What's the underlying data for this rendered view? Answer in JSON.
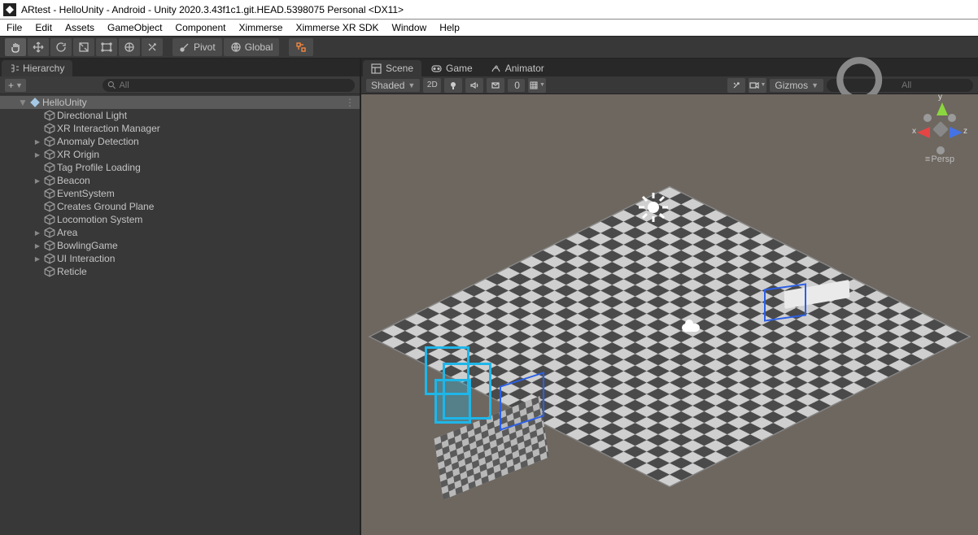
{
  "window": {
    "title": "ARtest - HelloUnity - Android - Unity 2020.3.43f1c1.git.HEAD.5398075 Personal <DX11>"
  },
  "menubar": {
    "items": [
      "File",
      "Edit",
      "Assets",
      "GameObject",
      "Component",
      "Ximmerse",
      "Ximmerse XR SDK",
      "Window",
      "Help"
    ]
  },
  "toolbar": {
    "pivot_label": "Pivot",
    "global_label": "Global"
  },
  "hierarchy": {
    "tab_label": "Hierarchy",
    "add_label": "+",
    "search_placeholder": "All",
    "scene_name": "HelloUnity",
    "items": [
      {
        "name": "Directional Light",
        "indent": 2,
        "expandable": false
      },
      {
        "name": "XR Interaction Manager",
        "indent": 2,
        "expandable": false
      },
      {
        "name": "Anomaly Detection",
        "indent": 2,
        "expandable": true
      },
      {
        "name": "XR Origin",
        "indent": 2,
        "expandable": true
      },
      {
        "name": "Tag Profile Loading",
        "indent": 2,
        "expandable": false
      },
      {
        "name": "Beacon",
        "indent": 2,
        "expandable": true
      },
      {
        "name": "EventSystem",
        "indent": 2,
        "expandable": false
      },
      {
        "name": "Creates Ground Plane",
        "indent": 2,
        "expandable": false
      },
      {
        "name": "Locomotion System",
        "indent": 2,
        "expandable": false
      },
      {
        "name": "Area",
        "indent": 2,
        "expandable": true
      },
      {
        "name": "BowlingGame",
        "indent": 2,
        "expandable": true
      },
      {
        "name": "UI Interaction",
        "indent": 2,
        "expandable": true
      },
      {
        "name": "Reticle",
        "indent": 2,
        "expandable": false
      }
    ]
  },
  "scene_panel": {
    "tabs": [
      {
        "label": "Scene",
        "active": true
      },
      {
        "label": "Game",
        "active": false
      },
      {
        "label": "Animator",
        "active": false
      }
    ],
    "shading_label": "Shaded",
    "mode_2d": "2D",
    "fx_count": "0",
    "gizmos_label": "Gizmos",
    "search_placeholder": "All",
    "persp_label": "Persp",
    "axes": {
      "x": "x",
      "y": "y",
      "z": "z"
    }
  }
}
